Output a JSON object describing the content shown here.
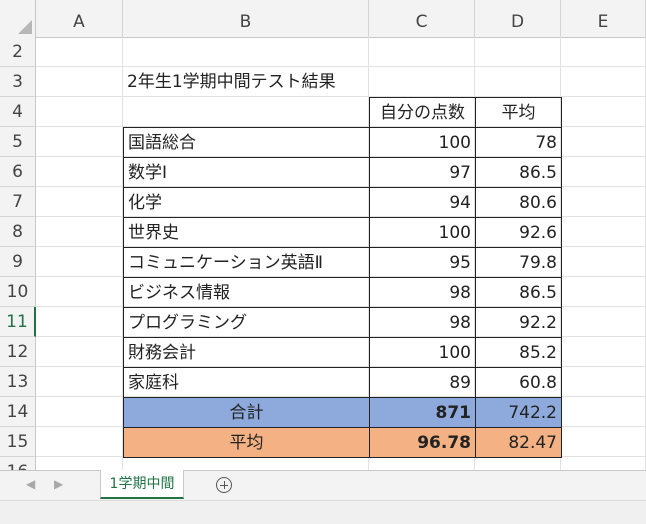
{
  "columns": [
    "A",
    "B",
    "C",
    "D",
    "E"
  ],
  "rows": [
    "2",
    "3",
    "4",
    "5",
    "6",
    "7",
    "8",
    "9",
    "10",
    "11",
    "12",
    "13",
    "14",
    "15",
    "16"
  ],
  "title": "2年生1学期中間テスト結果",
  "header": {
    "score": "自分の点数",
    "avg": "平均"
  },
  "subjects": [
    {
      "name": "国語総合",
      "score": "100",
      "avg": "78"
    },
    {
      "name": "数学Ⅰ",
      "score": "97",
      "avg": "86.5"
    },
    {
      "name": "化学",
      "score": "94",
      "avg": "80.6"
    },
    {
      "name": "世界史",
      "score": "100",
      "avg": "92.6"
    },
    {
      "name": "コミュニケーション英語Ⅱ",
      "score": "95",
      "avg": "79.8"
    },
    {
      "name": "ビジネス情報",
      "score": "98",
      "avg": "86.5"
    },
    {
      "name": "プログラミング",
      "score": "98",
      "avg": "92.2"
    },
    {
      "name": "財務会計",
      "score": "100",
      "avg": "85.2"
    },
    {
      "name": "家庭科",
      "score": "89",
      "avg": "60.8"
    }
  ],
  "total": {
    "label": "合計",
    "score": "871",
    "avg": "742.2"
  },
  "average": {
    "label": "平均",
    "score": "96.78",
    "avg": "82.47"
  },
  "sheet_tab": "1学期中間",
  "nav_prev": "◀",
  "nav_next": "▶",
  "colors": {
    "total_fill": "#8ea9db",
    "average_fill": "#f4b183",
    "accent": "#217346"
  }
}
